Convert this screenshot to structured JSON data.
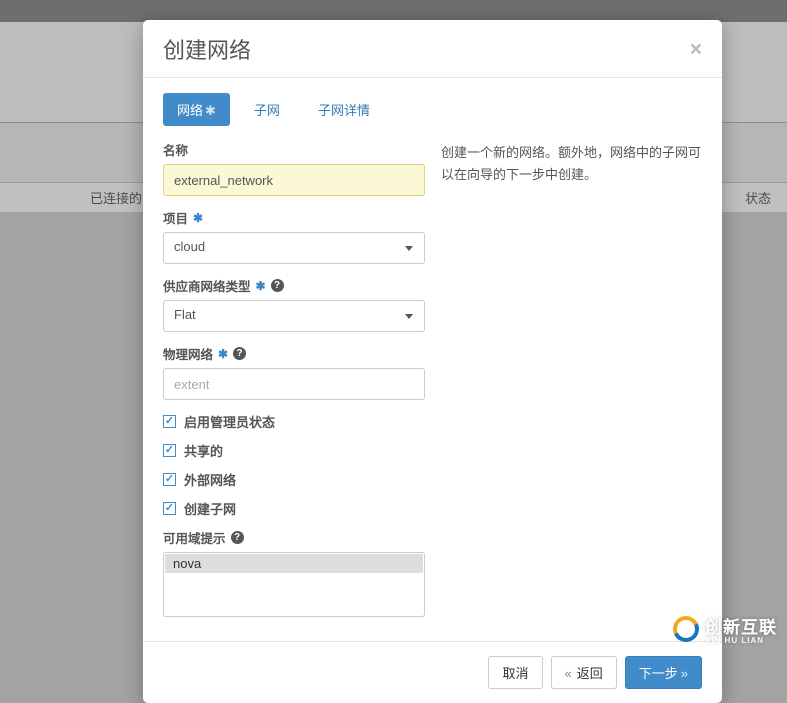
{
  "background": {
    "left_label": "已连接的",
    "right_label": "状态"
  },
  "modal": {
    "title": "创建网络",
    "tabs": {
      "network": "网络",
      "subnet": "子网",
      "subnet_details": "子网详情"
    },
    "description": "创建一个新的网络。额外地，网络中的子网可以在向导的下一步中创建。",
    "labels": {
      "name": "名称",
      "project": "项目",
      "provider_type": "供应商网络类型",
      "physical_network": "物理网络",
      "admin_state": "启用管理员状态",
      "shared": "共享的",
      "external": "外部网络",
      "create_subnet": "创建子网",
      "az_hints": "可用域提示"
    },
    "required_marker": "✱",
    "values": {
      "name": "external_network",
      "project": "cloud",
      "provider_type": "Flat",
      "physical_network_placeholder": "extent",
      "admin_state": true,
      "shared": true,
      "external": true,
      "create_subnet": true,
      "az_hints": [
        "nova"
      ]
    },
    "buttons": {
      "cancel": "取消",
      "back": "返回",
      "next": "下一步"
    }
  },
  "watermark": {
    "text": "创新互联",
    "sub": "XIN HU LIAN"
  }
}
